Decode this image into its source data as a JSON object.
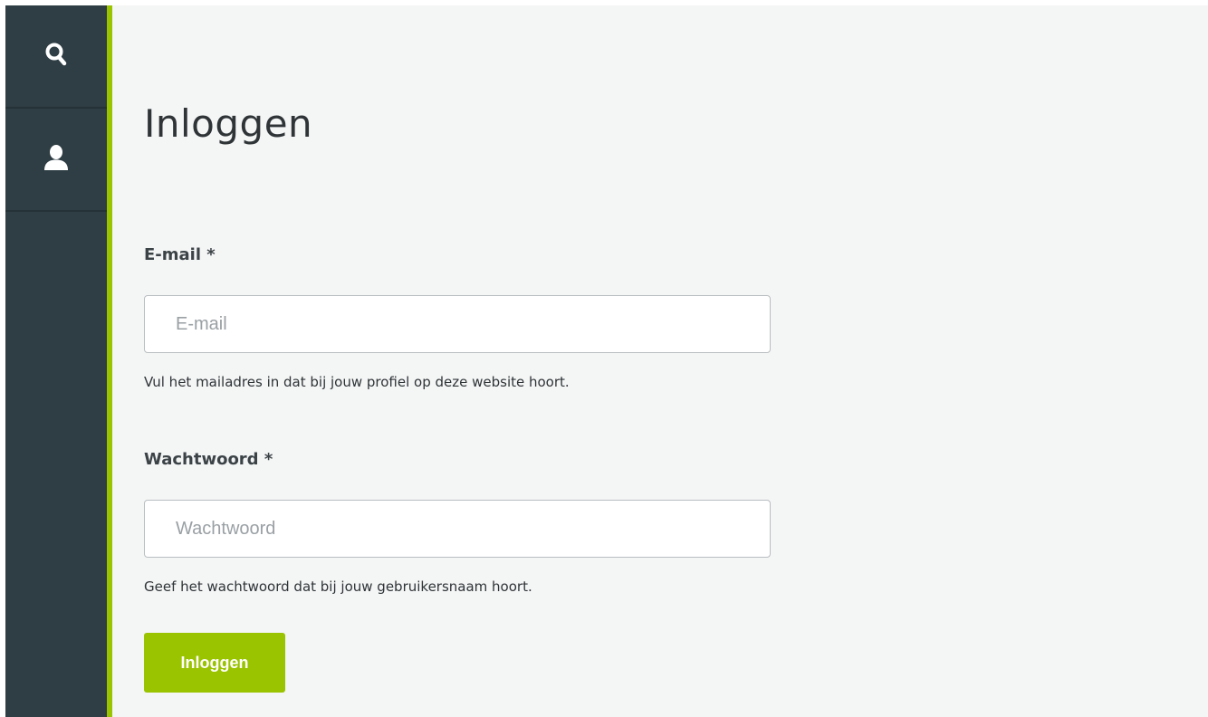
{
  "colors": {
    "accent": "#9ac300",
    "sidebar_bg": "#2f3e44",
    "page_bg": "#f4f5f5"
  },
  "sidebar": {
    "items": [
      {
        "name": "search",
        "icon": "search-icon"
      },
      {
        "name": "account",
        "icon": "user-icon"
      }
    ]
  },
  "page": {
    "title": "Inloggen"
  },
  "form": {
    "email": {
      "label": "E-mail *",
      "placeholder": "E-mail",
      "value": "",
      "help": "Vul het mailadres in dat bij jouw profiel op deze website hoort."
    },
    "password": {
      "label": "Wachtwoord *",
      "placeholder": "Wachtwoord",
      "value": "",
      "help": "Geef het wachtwoord dat bij jouw gebruikersnaam hoort."
    },
    "submit_label": "Inloggen"
  }
}
